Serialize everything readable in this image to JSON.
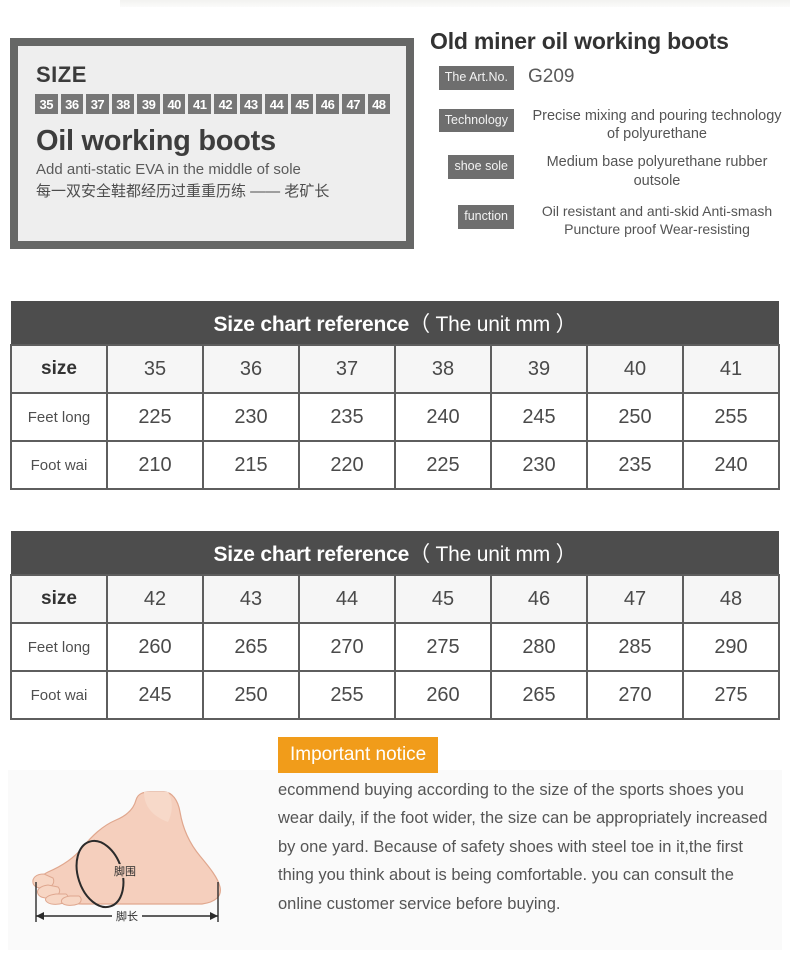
{
  "hero": {
    "size_box": {
      "size_label": "SIZE",
      "sizes": [
        "35",
        "36",
        "37",
        "38",
        "39",
        "40",
        "41",
        "42",
        "43",
        "44",
        "45",
        "46",
        "47",
        "48"
      ],
      "title": "Oil working boots",
      "subtitle_en": "Add anti-static EVA in the middle of sole",
      "subtitle_cn": "每一双安全鞋都经历过重重历练 —— 老矿长"
    },
    "spec": {
      "title": "Old miner oil working boots",
      "rows": [
        {
          "tag": "The Art.No.",
          "value": "G209"
        },
        {
          "tag": "Technology",
          "value": "Precise mixing and pouring technology of polyurethane"
        },
        {
          "tag": "shoe sole",
          "value": "Medium base polyurethane rubber outsole"
        },
        {
          "tag": "function",
          "value": "Oil resistant and anti-skid Anti-smash Puncture proof Wear-resisting"
        }
      ]
    }
  },
  "tables": [
    {
      "caption_main": "Size chart reference",
      "caption_unit": "（ The unit mm ）",
      "row_headers": [
        "size",
        "Feet long",
        "Foot wai"
      ],
      "sizes": [
        "35",
        "36",
        "37",
        "38",
        "39",
        "40",
        "41"
      ],
      "feet_long": [
        "225",
        "230",
        "235",
        "240",
        "245",
        "250",
        "255"
      ],
      "foot_wai": [
        "210",
        "215",
        "220",
        "225",
        "230",
        "235",
        "240"
      ]
    },
    {
      "caption_main": "Size chart reference",
      "caption_unit": "（ The unit mm ）",
      "row_headers": [
        "size",
        "Feet long",
        "Foot wai"
      ],
      "sizes": [
        "42",
        "43",
        "44",
        "45",
        "46",
        "47",
        "48"
      ],
      "feet_long": [
        "260",
        "265",
        "270",
        "275",
        "280",
        "285",
        "290"
      ],
      "foot_wai": [
        "245",
        "250",
        "255",
        "260",
        "265",
        "270",
        "275"
      ]
    }
  ],
  "notice": {
    "badge": "Important notice",
    "body": "ecommend buying according to the size of the sports shoes you wear daily, if the foot wider, the size can be appropriately increased by one yard. Because of safety shoes with steel toe in it,the first thing you think about is being comfortable. you can consult the online customer service before buying.",
    "diagram": {
      "circumference_label": "脚围",
      "length_label": "脚长"
    }
  },
  "colors": {
    "dark_gray": "#4d4d4d",
    "tag_gray": "#6e6e6e",
    "chip_gray": "#767676",
    "border_gray": "#5e5e5e",
    "orange": "#f19c1a",
    "panel_bg": "#eeeeee"
  }
}
